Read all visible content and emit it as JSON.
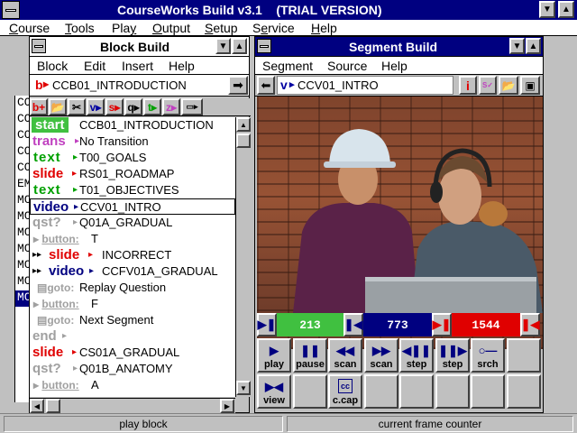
{
  "app": {
    "title": "CourseWorks Build v3.1    (TRIAL VERSION)",
    "menu": [
      "Course",
      "Tools",
      "Play",
      "Output",
      "Setup",
      "Service",
      "Help"
    ],
    "menu_access": [
      "C",
      "T",
      "y",
      "O",
      "S",
      "e",
      "H"
    ]
  },
  "background_list": [
    "CO",
    "CO",
    "CO",
    "CO",
    "CO",
    "EM",
    "MC",
    "MC",
    "MC",
    "MC",
    "MC",
    "MC",
    "MC"
  ],
  "block_build": {
    "title": "Block Build",
    "menu": [
      "Block",
      "Edit",
      "Insert",
      "Help"
    ],
    "block_prefix": "b",
    "block_name": "CCB01_INTRODUCTION",
    "tools": [
      "b+",
      "open",
      "cut",
      "v",
      "s",
      "q",
      "t",
      "z",
      "..."
    ],
    "rows": [
      {
        "kw": "start",
        "kwtext": "start",
        "name": "CCB01_INTRODUCTION"
      },
      {
        "kw": "trans",
        "kwtext": "trans",
        "arrow": "▸",
        "name": "No Transition"
      },
      {
        "kw": "text",
        "kwtext": "text",
        "arrow": "▸",
        "name": "T00_GOALS"
      },
      {
        "kw": "slide",
        "kwtext": "slide",
        "arrow": "▸",
        "name": "RS01_ROADMAP"
      },
      {
        "kw": "text",
        "kwtext": "text",
        "arrow": "▸",
        "name": "T01_OBJECTIVES"
      },
      {
        "kw": "video",
        "kwtext": "video",
        "arrow": "▸",
        "name": "CCV01_INTRO",
        "selected": true
      },
      {
        "kw": "qst",
        "kwtext": "qst?",
        "arrow": "▸",
        "name": "Q01A_GRADUAL"
      },
      {
        "kw": "button",
        "kwtext": "button:",
        "name": "T"
      },
      {
        "kw": "slide",
        "kwtext": "slide",
        "arrow": "▸",
        "name": "INCORRECT",
        "indent": 2
      },
      {
        "kw": "video",
        "kwtext": "video",
        "arrow": "▸",
        "name": "CCFV01A_GRADUAL",
        "indent": 2
      },
      {
        "kw": "goto",
        "kwtext": "goto:",
        "name": "Replay Question"
      },
      {
        "kw": "button",
        "kwtext": "button:",
        "name": "F"
      },
      {
        "kw": "goto",
        "kwtext": "goto:",
        "name": "Next Segment"
      },
      {
        "kw": "end",
        "kwtext": "end",
        "arrow": "▸",
        "name": ""
      },
      {
        "kw": "slide",
        "kwtext": "slide",
        "arrow": "▸",
        "name": "CS01A_GRADUAL"
      },
      {
        "kw": "qst",
        "kwtext": "qst?",
        "arrow": "▸",
        "name": "Q01B_ANATOMY"
      },
      {
        "kw": "button",
        "kwtext": "button:",
        "name": "A"
      }
    ]
  },
  "segment_build": {
    "title": "Segment Build",
    "menu": [
      "Segment",
      "Source",
      "Help"
    ],
    "segment_prefix": "v",
    "segment_name": "CCV01_INTRO",
    "counters": {
      "start": "213",
      "current": "773",
      "end": "1544"
    },
    "controls_row1": [
      {
        "label": "play",
        "icon": "▶"
      },
      {
        "label": "pause",
        "icon": "❚❚"
      },
      {
        "label": "scan",
        "icon": "◀◀"
      },
      {
        "label": "scan",
        "icon": "▶▶"
      },
      {
        "label": "step",
        "icon": "◀❚❚"
      },
      {
        "label": "step",
        "icon": "❚❚▶"
      },
      {
        "label": "srch",
        "icon": "○—"
      },
      {
        "label": "",
        "icon": ""
      }
    ],
    "controls_row2": [
      {
        "label": "view",
        "icon": "▶◀"
      },
      {
        "label": "",
        "icon": ""
      },
      {
        "label": "c.cap",
        "icon": "cc"
      },
      {
        "label": "",
        "icon": ""
      },
      {
        "label": "",
        "icon": ""
      },
      {
        "label": "",
        "icon": ""
      },
      {
        "label": "",
        "icon": ""
      },
      {
        "label": "",
        "icon": ""
      }
    ]
  },
  "status": {
    "left": "play block",
    "right": "current frame counter"
  },
  "colors": {
    "title_active": "#000080",
    "start_green": "#40c040",
    "current_blue": "#000080",
    "end_red": "#e00000"
  }
}
